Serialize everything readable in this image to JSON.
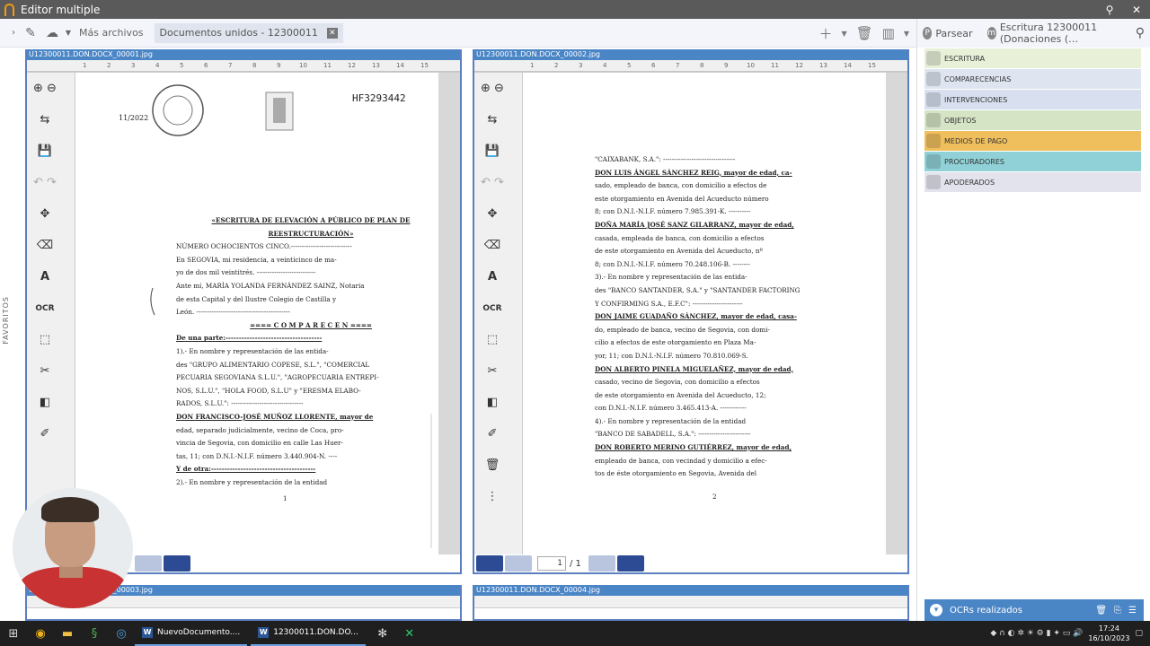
{
  "window": {
    "title": "Editor multiple"
  },
  "toolbar": {
    "mas_archivos": "Más archivos",
    "doc_tab": "Documentos unidos - 12300011"
  },
  "right_panel": {
    "parsear": "Parsear",
    "escritura_title": "Escritura 12300011 (Donaciones (…",
    "categories": [
      {
        "label": "ESCRITURA",
        "color": "#e8f0d8"
      },
      {
        "label": "COMPARECENCIAS",
        "color": "#dfe5f0"
      },
      {
        "label": "INTERVENCIONES",
        "color": "#d8e0ef"
      },
      {
        "label": "OBJETOS",
        "color": "#d6e4c6"
      },
      {
        "label": "MEDIOS DE PAGO",
        "color": "#efbf5e"
      },
      {
        "label": "PROCURADORES",
        "color": "#8fd1d6"
      },
      {
        "label": "APODERADOS",
        "color": "#e3e3ee"
      }
    ],
    "ocr_label": "OCRs realizados"
  },
  "favoritos": "FAVORITOS",
  "panes": [
    {
      "title": "U12300011.DON.DOCX_00001.jpg",
      "page_number": "1"
    },
    {
      "title": "U12300011.DON.DOCX_00002.jpg",
      "page_number": "2",
      "page_input": "1",
      "page_total": "/ 1"
    },
    {
      "title": "U12300011.DON.DOCX_00003.jpg"
    },
    {
      "title": "U12300011.DON.DOCX_00004.jpg"
    }
  ],
  "tools": {
    "ocr": "OCR"
  },
  "page1": {
    "date": "11/2022",
    "serial": "HF3293442",
    "lines": [
      "«ESCRITURA DE ELEVACIÓN A PÚBLICO DE PLAN DE",
      "REESTRUCTURACIÓN»",
      "NÚMERO OCHOCIENTOS CINCO.----------------------------",
      "En SEGOVIA, mi residencia, a veinticinco de ma-",
      "yo de dos mil veintitrés. ---------------------------",
      "Ante mí, MARÍA YOLANDA FERNÁNDEZ SAINZ, Notaria",
      "de esta Capital y del Ilustre Colegio de Castilla y",
      "León. -------------------------------------------",
      "==== C O M P A R E C E N ====",
      "De una parte:------------------------------------",
      "1).- En nombre y representación de las entida-",
      "des \"GRUPO ALIMENTARIO COPESE, S.L.\", \"COMERCIAL",
      "PECUARIA SEGOVIANA S.L.U.\", \"AGROPECUARIA ENTREPI-",
      "NOS, S.L.U.\", \"HOLA FOOD, S.L.U\" y \"ERESMA ELABO-",
      "RADOS, S.L.U.\": ---------------------------------",
      "DON FRANCISCO-JOSÉ MUÑOZ LLORENTE, mayor de",
      "edad, separado judicialmente, vecino de Coca, pro-",
      "vincia de Segovia, con domicilio en calle Las Huer-",
      "tas, 11; con D.N.I.-N.I.F. número 3.440.904-N. ----",
      "Y de otra:---------------------------------------",
      "2).- En nombre y representación de la entidad"
    ]
  },
  "page2": {
    "lines": [
      "\"CAIXABANK, S.A.\": ---------------------------------",
      "DON LUIS ÁNGEL SÁNCHEZ REIG, mayor de edad, ca-",
      "sado, empleado de banca, con domicilio a efectos de",
      "este otorgamiento en Avenida del Acueducto número",
      "8; con D.N.I.-N.I.F. número 7.985.391-K. ----------",
      "DOÑA MARÍA JOSÉ SANZ GILARRANZ, mayor de edad,",
      "casada, empleada de banca, con domicilio a efectos",
      "de este otorgamiento en Avenida del Acueducto, nº",
      "8; con D.N.I.-N.I.F. número 70.248.106-B. --------",
      "3).- En nombre y representación de las entida-",
      "des \"BANCO SANTANDER, S.A.\" y \"SANTANDER FACTORING",
      "Y CONFIRMING S.A., E.F.C\": -----------------------",
      "DON JAIME GUADAÑO SÁNCHEZ, mayor de edad, casa-",
      "do, empleado de banca, vecino de Segovia, con domi-",
      "cilio a efectos de este otorgamiento en Plaza Ma-",
      "yor, 11; con D.N.I.-N.I.F. número 70.810.069-S.",
      "DON ALBERTO PINELA MIGUELAÑEZ, mayor de edad,",
      "casado, vecino de Segovia, con domicilio a efectos",
      "de este otorgamiento en Avenida del Acueducto, 12;",
      "con D.N.I.-N.I.F. número 3.465.413-A. ------------",
      "4).- En nombre y representación de la entidad",
      "\"BANCO DE SABADELL, S.A.\": ------------------------",
      "DON ROBERTO MERINO GUTIÉRREZ, mayor de edad,",
      "empleado de banca, con vecindad y domicilio a efec-",
      "tos de éste otorgamiento en Segovia, Avenida del"
    ]
  },
  "taskbar": {
    "app1": "NuevoDocumento....",
    "app2": "12300011.DON.DO...",
    "time": "17:24",
    "date": "16/10/2023"
  }
}
